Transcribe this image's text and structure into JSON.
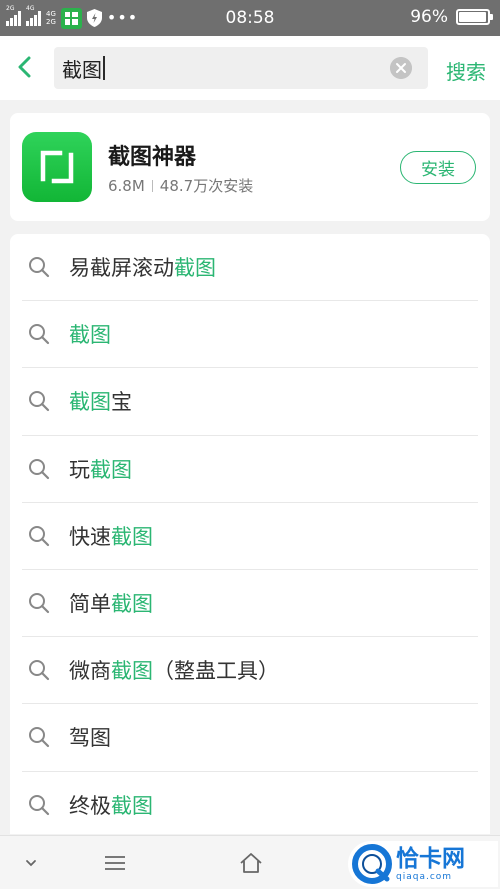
{
  "status_bar": {
    "sim1_label": "2G",
    "sim2_label": "4G",
    "net_top": "4G",
    "net_bottom": "2G",
    "overflow": "•••",
    "time": "08:58",
    "battery_percent": "96%",
    "battery_level": 0.96,
    "icons": [
      "signal-icon",
      "app-notification-icon",
      "shield-icon",
      "battery-icon"
    ]
  },
  "search": {
    "back_icon": "chevron-left-icon",
    "query": "截图",
    "clear_icon": "clear-icon",
    "search_button": "搜索"
  },
  "app_result": {
    "name": "截图神器",
    "size": "6.8M",
    "installs": "48.7万次安装",
    "install_button": "安装"
  },
  "suggestions": [
    {
      "before": "易截屏滚动",
      "highlight": "截图",
      "after": ""
    },
    {
      "before": "",
      "highlight": "截图",
      "after": ""
    },
    {
      "before": "",
      "highlight": "截图",
      "after": "宝"
    },
    {
      "before": "玩",
      "highlight": "截图",
      "after": ""
    },
    {
      "before": "快速",
      "highlight": "截图",
      "after": ""
    },
    {
      "before": "简单",
      "highlight": "截图",
      "after": ""
    },
    {
      "before": "微商",
      "highlight": "截图",
      "after": "（整蛊工具）"
    },
    {
      "before": "驾图",
      "highlight": "",
      "after": ""
    },
    {
      "before": "终极",
      "highlight": "截图",
      "after": ""
    }
  ],
  "bottom_nav": {
    "icons": [
      "chevron-down-icon",
      "menu-icon",
      "home-icon"
    ],
    "watermark_cn": "恰卡网",
    "watermark_en": "qiaqa.com"
  },
  "colors": {
    "accent": "#2bb673",
    "status_bar": "#6f6f6f",
    "app_green": "#1ec546",
    "watermark_blue": "#1676d6"
  }
}
